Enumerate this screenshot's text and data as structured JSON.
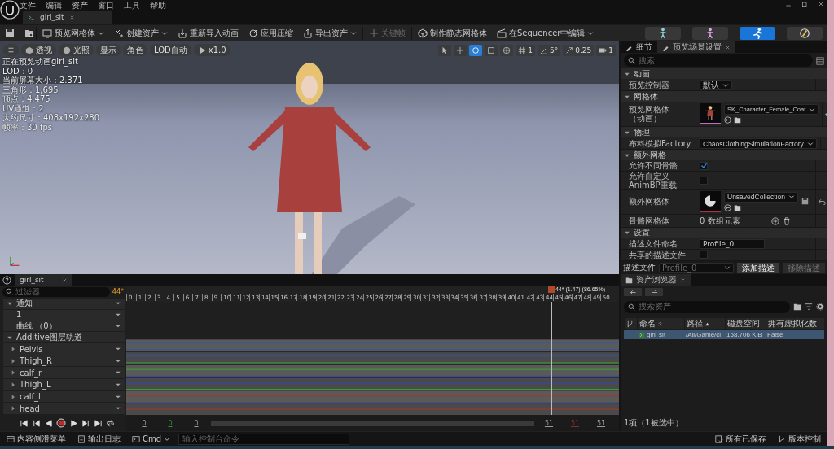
{
  "menu": [
    "文件",
    "编辑",
    "资产",
    "窗口",
    "工具",
    "帮助"
  ],
  "document_tab": {
    "title": "girl_sit"
  },
  "toolbar": {
    "items": [
      {
        "label": "预览网格体",
        "dropdown": true,
        "disabled": false
      },
      {
        "label": "创建资产",
        "dropdown": true,
        "disabled": false
      },
      {
        "label": "重新导入动画",
        "dropdown": false,
        "disabled": false
      },
      {
        "label": "应用压缩",
        "dropdown": false,
        "disabled": false
      },
      {
        "label": "导出资产",
        "dropdown": true,
        "disabled": false
      },
      {
        "label": "关键帧",
        "dropdown": false,
        "disabled": true
      },
      {
        "label": "制作静态网格体",
        "dropdown": false,
        "disabled": false
      },
      {
        "label": "在Sequencer中编辑",
        "dropdown": true,
        "disabled": false
      }
    ],
    "modes": [
      {
        "selected": false
      },
      {
        "selected": false
      },
      {
        "selected": true
      },
      {
        "selected": false
      }
    ]
  },
  "viewport": {
    "buttons": [
      "透视",
      "光照",
      "显示",
      "角色",
      "LOD自动",
      "x1.0"
    ],
    "tools": [
      {
        "selected": false
      },
      {
        "selected": false
      },
      {
        "selected": true
      },
      {
        "selected": false
      },
      {
        "selected": false
      }
    ],
    "snap_values": [
      "1",
      "5°",
      "0.25",
      "1"
    ],
    "stats": [
      "正在预览动画girl_sit",
      "LOD：0",
      "当前屏幕大小：2.371",
      "三角形：1,695",
      "顶点：4,475",
      "UV通道：2",
      "大约尺寸：408x192x280",
      "帧率：30 fps"
    ]
  },
  "details": {
    "tabs": [
      {
        "label": "细节",
        "selected": false
      },
      {
        "label": "预览场景设置",
        "selected": true
      }
    ],
    "search": {
      "placeholder": "搜索"
    },
    "sections": [
      {
        "title": "动画",
        "expanded": true,
        "rows": [
          {
            "kind": "dropdown",
            "label": "预览控制器",
            "value": "默认"
          }
        ]
      },
      {
        "title": "网格体",
        "expanded": true,
        "rows": [
          {
            "kind": "asset",
            "label": "预览网格体",
            "sublabel": "（动画）",
            "value": "SK_Character_Female_Coat"
          }
        ]
      },
      {
        "title": "物理",
        "expanded": true,
        "rows": [
          {
            "kind": "dropdown",
            "label": "布料模拟Factory",
            "value": "ChaosClothingSimulationFactory"
          }
        ]
      },
      {
        "title": "额外网格",
        "expanded": true,
        "rows": [
          {
            "kind": "checkbox",
            "label": "允许不同骨骼",
            "checked": true
          },
          {
            "kind": "checkbox",
            "label": "允许自定义AnimBP重载",
            "checked": false
          },
          {
            "kind": "collection",
            "label": "额外网格体",
            "value": "UnsavedCollection"
          },
          {
            "kind": "array",
            "label": "骨骼网格体",
            "value": "0 数组元素"
          }
        ]
      },
      {
        "title": "设置",
        "expanded": true,
        "rows": [
          {
            "kind": "text",
            "label": "描述文件命名",
            "value": "Profile_0"
          },
          {
            "kind": "checkbox",
            "label": "共享的描述文件",
            "checked": false
          }
        ]
      }
    ],
    "footer": {
      "label": "描述文件",
      "value": "Profile_0",
      "add_button": "添加描述",
      "remove_button": "移除描述"
    }
  },
  "timeline": {
    "tab": "girl_sit",
    "filter": {
      "placeholder": "过滤器"
    },
    "current_frame": "44*",
    "tracks": [
      {
        "kind": "section",
        "label": "通知"
      },
      {
        "kind": "row",
        "label": "1"
      },
      {
        "kind": "row",
        "label": "曲线 （0）"
      },
      {
        "kind": "section",
        "label": "Additive图层轨道"
      },
      {
        "kind": "bone",
        "label": "Pelvis",
        "expanded": false
      },
      {
        "kind": "bone",
        "label": "Thigh_R",
        "expanded": false
      },
      {
        "kind": "bone",
        "label": "calf_r",
        "expanded": false
      },
      {
        "kind": "bone",
        "label": "Thigh_L",
        "expanded": false
      },
      {
        "kind": "bone",
        "label": "calf_l",
        "expanded": false
      },
      {
        "kind": "bone",
        "label": "head",
        "expanded": false
      }
    ],
    "frames": [
      "0",
      "1",
      "2",
      "3",
      "4",
      "5",
      "6",
      "7",
      "8",
      "9",
      "10",
      "11",
      "12",
      "13",
      "14",
      "15",
      "16",
      "17",
      "18",
      "19",
      "20",
      "21",
      "22",
      "23",
      "24",
      "25",
      "26",
      "27",
      "28",
      "29",
      "30",
      "31",
      "32",
      "33",
      "34",
      "35",
      "36",
      "37",
      "38",
      "39",
      "40",
      "41",
      "42",
      "43",
      "44",
      "45",
      "46",
      "47",
      "48",
      "49",
      "50"
    ],
    "playhead": {
      "label": "44* (1.47) (86.65%)",
      "level": 0.8627
    },
    "range_start": [
      "0",
      "0",
      "0"
    ],
    "range_end": [
      "51",
      "51",
      "51"
    ]
  },
  "asset_browser": {
    "tab": "资产浏览器",
    "search": {
      "placeholder": "搜索资产"
    },
    "columns": [
      "命名",
      "路径",
      "磁盘空间",
      "拥有虚拟化数"
    ],
    "rows": [
      {
        "cells": [
          "girl_sit",
          "/All/Game/cl",
          "158.706 KiB",
          "False"
        ],
        "selected": true
      }
    ],
    "footer": "1项（1被选中）"
  },
  "status_bar": {
    "left": [
      "内容侧滑菜单",
      "输出日志"
    ],
    "cmd": "Cmd",
    "console": {
      "placeholder": "输入控制台命令"
    },
    "right": [
      "所有已保存",
      "版本控制"
    ]
  }
}
